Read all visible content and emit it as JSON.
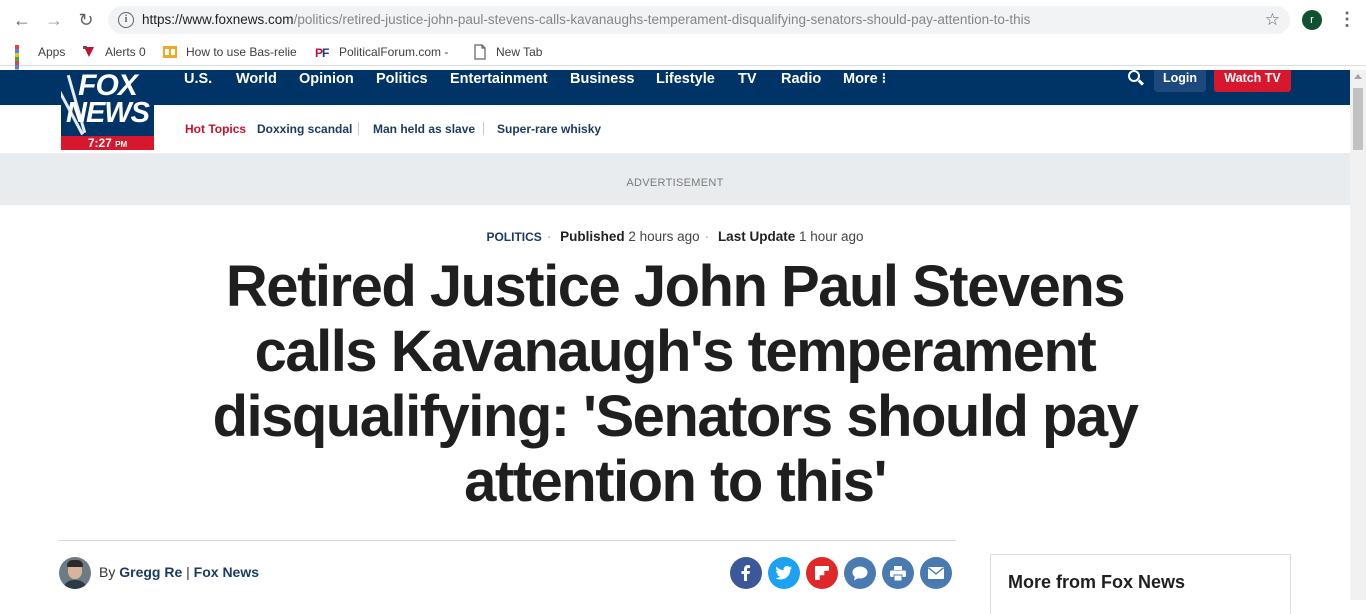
{
  "browser": {
    "url_host": "https://www.foxnews.com",
    "url_path": "/politics/retired-justice-john-paul-stevens-calls-kavanaughs-temperament-disqualifying-senators-should-pay-attention-to-this",
    "profile_initial": "r",
    "bookmarks": [
      {
        "label": "Apps",
        "icon": "apps-grid-icon"
      },
      {
        "label": "Alerts 0",
        "icon": "alerts-icon"
      },
      {
        "label": "How to use Bas-relie",
        "icon": "bas-relief-icon"
      },
      {
        "label": "PoliticalForum.com -",
        "icon": "politicalforum-icon"
      },
      {
        "label": "New Tab",
        "icon": "page-icon"
      }
    ]
  },
  "fox": {
    "logo_line1": "FOX",
    "logo_line2": "NEWS",
    "time": "7:27",
    "time_suffix": "PM",
    "nav": [
      "U.S.",
      "World",
      "Opinion",
      "Politics",
      "Entertainment",
      "Business",
      "Lifestyle",
      "TV",
      "Radio",
      "More ⁝"
    ],
    "login": "Login",
    "watch_tv": "Watch TV",
    "hot_topics_label": "Hot Topics",
    "topics": [
      "Doxxing scandal",
      "Man held as slave",
      "Super-rare whisky"
    ],
    "advertisement": "ADVERTISEMENT",
    "colors": {
      "navy": "#003366",
      "red": "#d7172e"
    }
  },
  "article": {
    "category": "POLITICS",
    "published_label": "Published",
    "published_value": "2 hours ago",
    "updated_label": "Last Update",
    "updated_value": "1 hour ago",
    "headline": "Retired Justice John Paul Stevens calls Kavanaugh's temperament disqualifying: 'Senators should pay attention to this'",
    "by_prefix": "By",
    "author": "Gregg Re",
    "outlet": "Fox News",
    "share_icons": [
      "facebook-icon",
      "twitter-icon",
      "flipboard-icon",
      "comment-icon",
      "print-icon",
      "email-icon"
    ]
  },
  "sidebar": {
    "title": "More from Fox News"
  }
}
